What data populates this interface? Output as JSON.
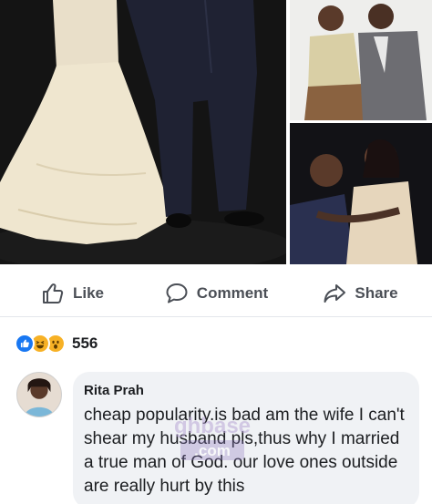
{
  "actions": {
    "like_label": "Like",
    "comment_label": "Comment",
    "share_label": "Share"
  },
  "reactions": {
    "icons": [
      "like-reaction",
      "haha-reaction",
      "wow-reaction"
    ],
    "count": "556"
  },
  "comment": {
    "author": "Rita Prah",
    "text": "cheap popularity.is bad am the wife I can't shear my husband pls,thus why I married a true man of God. our love ones outside are really hurt by this"
  },
  "colors": {
    "like_blue": "#1877f2",
    "reaction_yellow": "#f7b125",
    "action_gray": "#4b4f56",
    "bubble_bg": "#f0f2f5"
  }
}
